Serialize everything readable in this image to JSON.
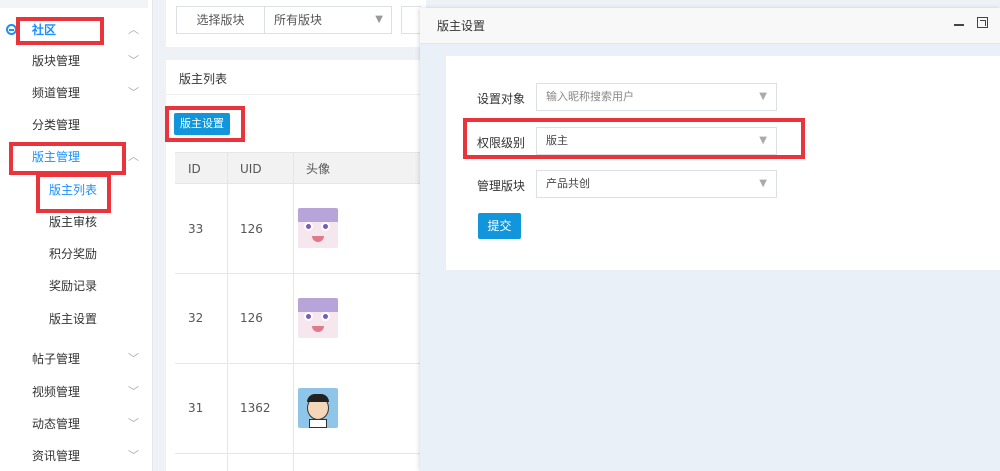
{
  "sidebar": {
    "community": {
      "label": "社区",
      "chevron": "︿"
    },
    "items": [
      {
        "label": "版块管理",
        "chevron": "﹀"
      },
      {
        "label": "频道管理",
        "chevron": "﹀"
      },
      {
        "label": "分类管理"
      },
      {
        "label": "版主管理",
        "chevron": "︿"
      }
    ],
    "moderator_sub": [
      {
        "label": "版主列表"
      },
      {
        "label": "版主审核"
      },
      {
        "label": "积分奖励"
      },
      {
        "label": "奖励记录"
      },
      {
        "label": "版主设置"
      }
    ],
    "more": [
      {
        "label": "帖子管理",
        "chevron": "﹀"
      },
      {
        "label": "视频管理",
        "chevron": "﹀"
      },
      {
        "label": "动态管理",
        "chevron": "﹀"
      },
      {
        "label": "资讯管理",
        "chevron": "﹀"
      }
    ]
  },
  "filter": {
    "select_label": "选择版块",
    "select_value": "所有版块",
    "caret": "▼"
  },
  "list": {
    "title": "版主列表",
    "set_button": "版主设置",
    "columns": {
      "id": "ID",
      "uid": "UID",
      "avatar": "头像"
    },
    "rows": [
      {
        "id": "33",
        "uid": "126",
        "avatar": "anime-avatar"
      },
      {
        "id": "32",
        "uid": "126",
        "avatar": "anime-avatar"
      },
      {
        "id": "31",
        "uid": "1362",
        "avatar": "cartoon-avatar"
      }
    ]
  },
  "modal": {
    "title": "版主设置",
    "fields": {
      "target_label": "设置对象",
      "target_placeholder": "输入昵称搜索用户",
      "level_label": "权限级别",
      "level_value": "版主",
      "board_label": "管理版块",
      "board_value": "产品共创"
    },
    "caret": "▼",
    "submit": "提交"
  },
  "colors": {
    "accent": "#1890ff",
    "primary_button": "#1296db",
    "annotation": "#e8343a"
  }
}
